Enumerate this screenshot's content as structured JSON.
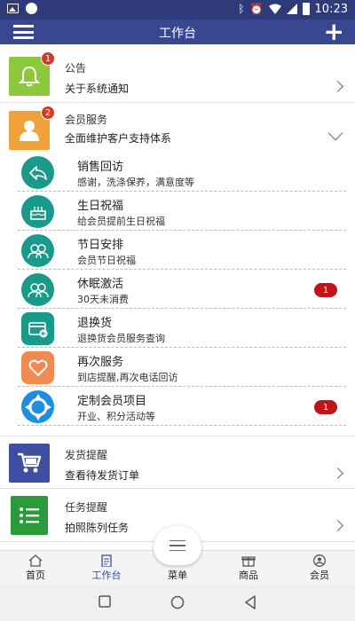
{
  "status_bar": {
    "time": "10:23",
    "icons": [
      "image-icon",
      "circle-icon",
      "bluetooth-icon",
      "alarm-icon",
      "wifi-icon",
      "signal-icon",
      "battery-icon"
    ]
  },
  "header": {
    "title": "工作台",
    "menu_icon": "hamburger-icon",
    "add_icon": "plus-icon"
  },
  "sections": {
    "announcement": {
      "title": "公告",
      "subtitle": "关于系统通知",
      "badge": "1",
      "icon": "bell-icon",
      "color": "#8cc83c"
    },
    "member": {
      "title": "会员服务",
      "subtitle": "全面维护客户支持体系",
      "badge": "2",
      "icon": "person-icon",
      "color": "#f2a23a"
    },
    "shipping": {
      "title": "发货提醒",
      "subtitle": "查看待发货订单",
      "icon": "cart-icon",
      "color": "#3f4ea0"
    },
    "task": {
      "title": "任务提醒",
      "subtitle": "拍照陈列任务",
      "icon": "list-icon",
      "color": "#2a9a3a"
    }
  },
  "member_items": [
    {
      "title": "销售回访",
      "desc": "感谢，洗涤保养，满意度等",
      "icon": "reply-icon",
      "color": "#1a9a8a"
    },
    {
      "title": "生日祝福",
      "desc": "给会员提前生日祝福",
      "icon": "cake-icon",
      "color": "#1a9a8a"
    },
    {
      "title": "节日安排",
      "desc": "会员节日祝福",
      "icon": "people-icon",
      "color": "#1a9a8a"
    },
    {
      "title": "休眠激活",
      "desc": "30天未消费",
      "icon": "people-icon",
      "color": "#1a9a8a",
      "badge": "1"
    },
    {
      "title": "退换货",
      "desc": "退换货会员服务查询",
      "icon": "card-icon",
      "color": "#1a9a8a"
    },
    {
      "title": "再次服务",
      "desc": "到店提醒,再次电话回访",
      "icon": "heart-icon",
      "color": "#f08a50"
    },
    {
      "title": "定制会员项目",
      "desc": "开业、积分活动等",
      "icon": "target-icon",
      "color": "#1e8ee0",
      "badge": "1"
    }
  ],
  "tabs": [
    {
      "label": "首页",
      "icon": "home-icon"
    },
    {
      "label": "工作台",
      "icon": "clipboard-icon"
    },
    {
      "label": "菜单",
      "icon": "menu-icon"
    },
    {
      "label": "商品",
      "icon": "gift-icon"
    },
    {
      "label": "会员",
      "icon": "user-circle-icon"
    }
  ],
  "colors": {
    "header": "#38478f",
    "status_bar": "#2f3a7a",
    "badge_red": "#c0141a",
    "active_tab": "#3a4a9a"
  }
}
